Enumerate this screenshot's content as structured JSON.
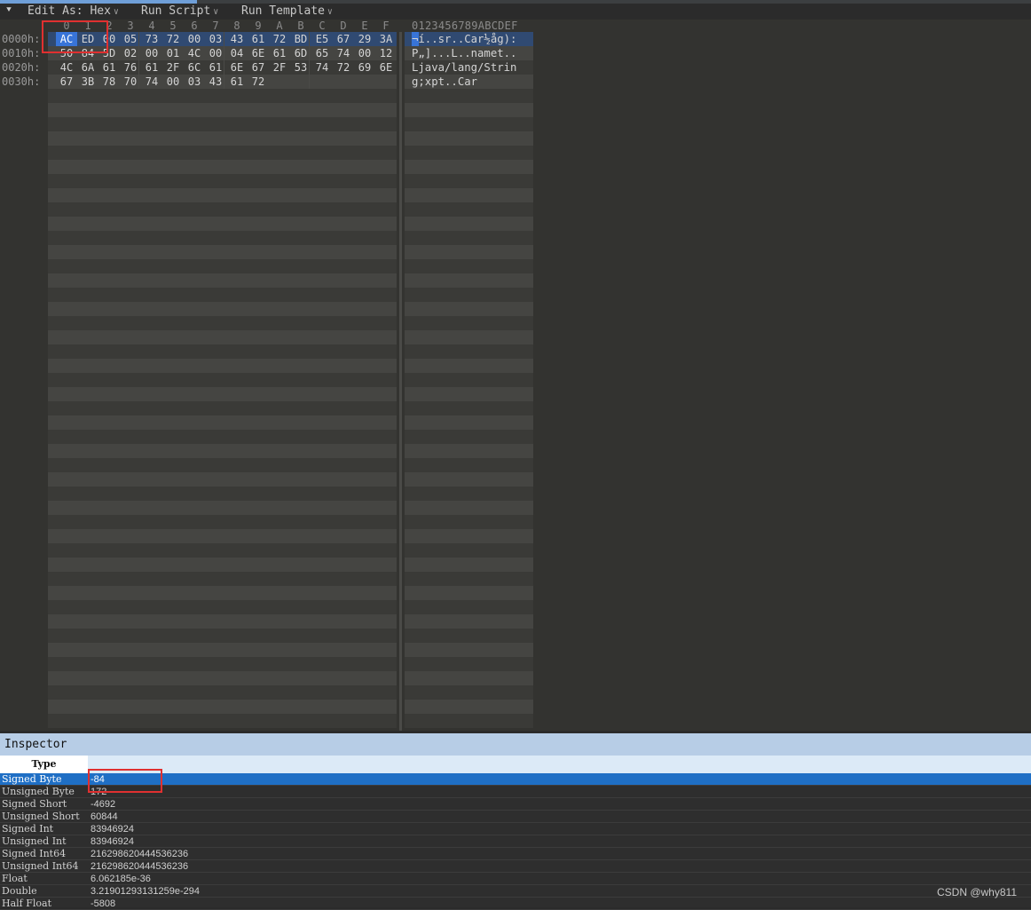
{
  "toolbar": {
    "edit_as_label": "Edit As: Hex",
    "run_script_label": "Run Script",
    "run_template_label": "Run Template"
  },
  "hex_header": {
    "columns": [
      "0",
      "1",
      "2",
      "3",
      "4",
      "5",
      "6",
      "7",
      "8",
      "9",
      "A",
      "B",
      "C",
      "D",
      "E",
      "F"
    ],
    "ascii": "0123456789ABCDEF"
  },
  "rows": [
    {
      "offset": "0000h:",
      "bytes": [
        "AC",
        "ED",
        "00",
        "05",
        "73",
        "72",
        "00",
        "03",
        "43",
        "61",
        "72",
        "BD",
        "E5",
        "67",
        "29",
        "3A"
      ],
      "ascii": "¬í..sr..Car½åg):"
    },
    {
      "offset": "0010h:",
      "bytes": [
        "50",
        "84",
        "5D",
        "02",
        "00",
        "01",
        "4C",
        "00",
        "04",
        "6E",
        "61",
        "6D",
        "65",
        "74",
        "00",
        "12"
      ],
      "ascii": "P„]...L..namet.."
    },
    {
      "offset": "0020h:",
      "bytes": [
        "4C",
        "6A",
        "61",
        "76",
        "61",
        "2F",
        "6C",
        "61",
        "6E",
        "67",
        "2F",
        "53",
        "74",
        "72",
        "69",
        "6E"
      ],
      "ascii": "Ljava/lang/Strin"
    },
    {
      "offset": "0030h:",
      "bytes": [
        "67",
        "3B",
        "78",
        "70",
        "74",
        "00",
        "03",
        "43",
        "61",
        "72"
      ],
      "ascii": "g;xpt..Car"
    }
  ],
  "inspector": {
    "title": "Inspector",
    "type_header": "Type",
    "rows": [
      {
        "type": "Signed Byte",
        "value": "-84",
        "selected": true
      },
      {
        "type": "Unsigned Byte",
        "value": "172"
      },
      {
        "type": "Signed Short",
        "value": "-4692"
      },
      {
        "type": "Unsigned Short",
        "value": "60844"
      },
      {
        "type": "Signed Int",
        "value": "83946924"
      },
      {
        "type": "Unsigned Int",
        "value": "83946924"
      },
      {
        "type": "Signed Int64",
        "value": "216298620444536236"
      },
      {
        "type": "Unsigned Int64",
        "value": "216298620444536236"
      },
      {
        "type": "Float",
        "value": "6.062185e-36"
      },
      {
        "type": "Double",
        "value": "3.21901293131259e-294"
      },
      {
        "type": "Half Float",
        "value": "-5808"
      }
    ]
  },
  "watermark": "CSDN @why811",
  "colors": {
    "selection": "#3874d8",
    "row_highlight": "#304a72",
    "annotation_red": "#e03030",
    "inspector_title_bg": "#b7cde6",
    "inspector_selected_row": "#1f6fc5"
  }
}
